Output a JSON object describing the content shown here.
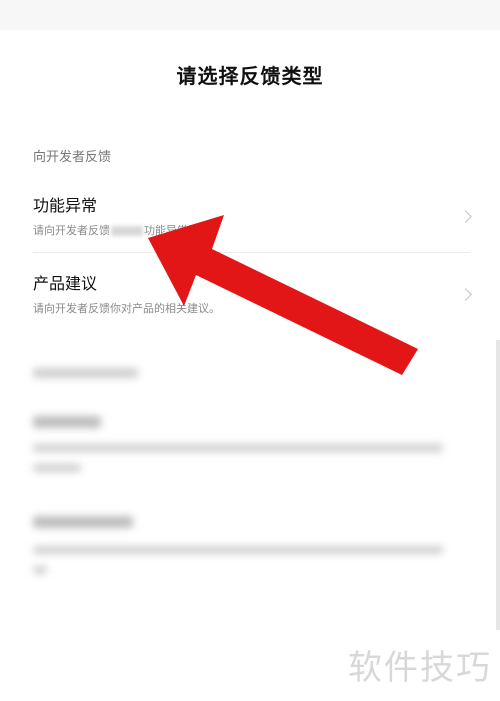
{
  "page": {
    "title": "请选择反馈类型",
    "section_label": "向开发者反馈"
  },
  "items": [
    {
      "title": "功能异常",
      "desc_prefix": "请向开发者反馈",
      "desc_suffix": "功能异常问题。"
    },
    {
      "title": "产品建议",
      "desc": "请向开发者反馈你对产品的相关建议。"
    }
  ],
  "watermark": "软件技巧",
  "colors": {
    "arrow": "#e21616",
    "background": "#ffffff",
    "text_primary": "#111111",
    "text_secondary": "#8a8a8a"
  },
  "icons": {
    "row_action": "chevron-right-icon",
    "annotation": "red-arrow-icon"
  }
}
